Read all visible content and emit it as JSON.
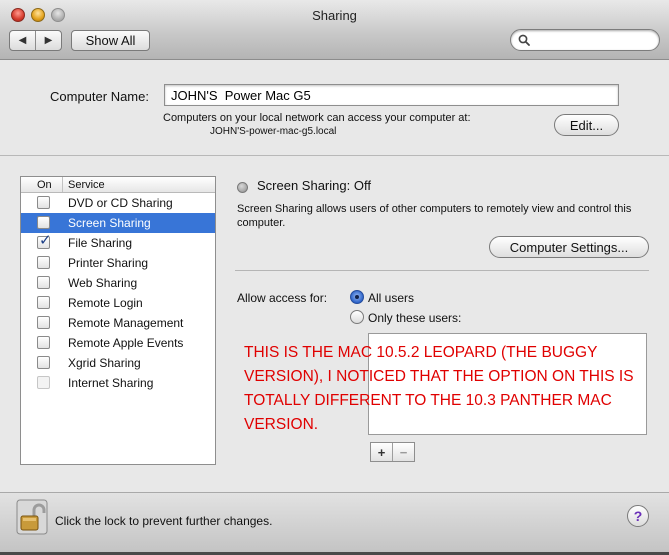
{
  "window": {
    "title": "Sharing"
  },
  "toolbar": {
    "back_glyph": "◀",
    "forward_glyph": "▶",
    "show_all_label": "Show All",
    "search_placeholder": ""
  },
  "computer_name": {
    "label": "Computer Name:",
    "value": "JOHN'S  Power Mac G5",
    "description": "Computers on your local network can access your computer at:",
    "hostname": "JOHN'S-power-mac-g5.local",
    "edit_label": "Edit..."
  },
  "services": {
    "header_on": "On",
    "header_service": "Service",
    "items": [
      {
        "name": "DVD or CD Sharing",
        "checked": false,
        "selected": false,
        "enabled": true
      },
      {
        "name": "Screen Sharing",
        "checked": false,
        "selected": true,
        "enabled": true
      },
      {
        "name": "File Sharing",
        "checked": true,
        "selected": false,
        "enabled": true
      },
      {
        "name": "Printer Sharing",
        "checked": false,
        "selected": false,
        "enabled": true
      },
      {
        "name": "Web Sharing",
        "checked": false,
        "selected": false,
        "enabled": true
      },
      {
        "name": "Remote Login",
        "checked": false,
        "selected": false,
        "enabled": true
      },
      {
        "name": "Remote Management",
        "checked": false,
        "selected": false,
        "enabled": true
      },
      {
        "name": "Remote Apple Events",
        "checked": false,
        "selected": false,
        "enabled": true
      },
      {
        "name": "Xgrid Sharing",
        "checked": false,
        "selected": false,
        "enabled": true
      },
      {
        "name": "Internet Sharing",
        "checked": false,
        "selected": false,
        "enabled": false
      }
    ]
  },
  "detail": {
    "status": "Screen Sharing: Off",
    "description": "Screen Sharing allows users of other computers to remotely view and control this computer.",
    "computer_settings_label": "Computer Settings...",
    "allow_access_label": "Allow access for:",
    "option_all_users": "All users",
    "option_only_these": "Only these users:",
    "selected_option": "all",
    "plus_label": "+",
    "minus_label": "−"
  },
  "annotation": {
    "text": "THIS IS THE MAC 10.5.2 LEOPARD (THE BUGGY VERSION), I NOTICED THAT THE OPTION ON THIS IS TOTALLY DIFFERENT TO THE 10.3 PANTHER MAC VERSION.",
    "color": "#e00000"
  },
  "footer": {
    "lock_text": "Click the lock to prevent further changes.",
    "help_glyph": "?"
  },
  "colors": {
    "selection": "#3875d7",
    "radio_on": "#2b62c8"
  }
}
